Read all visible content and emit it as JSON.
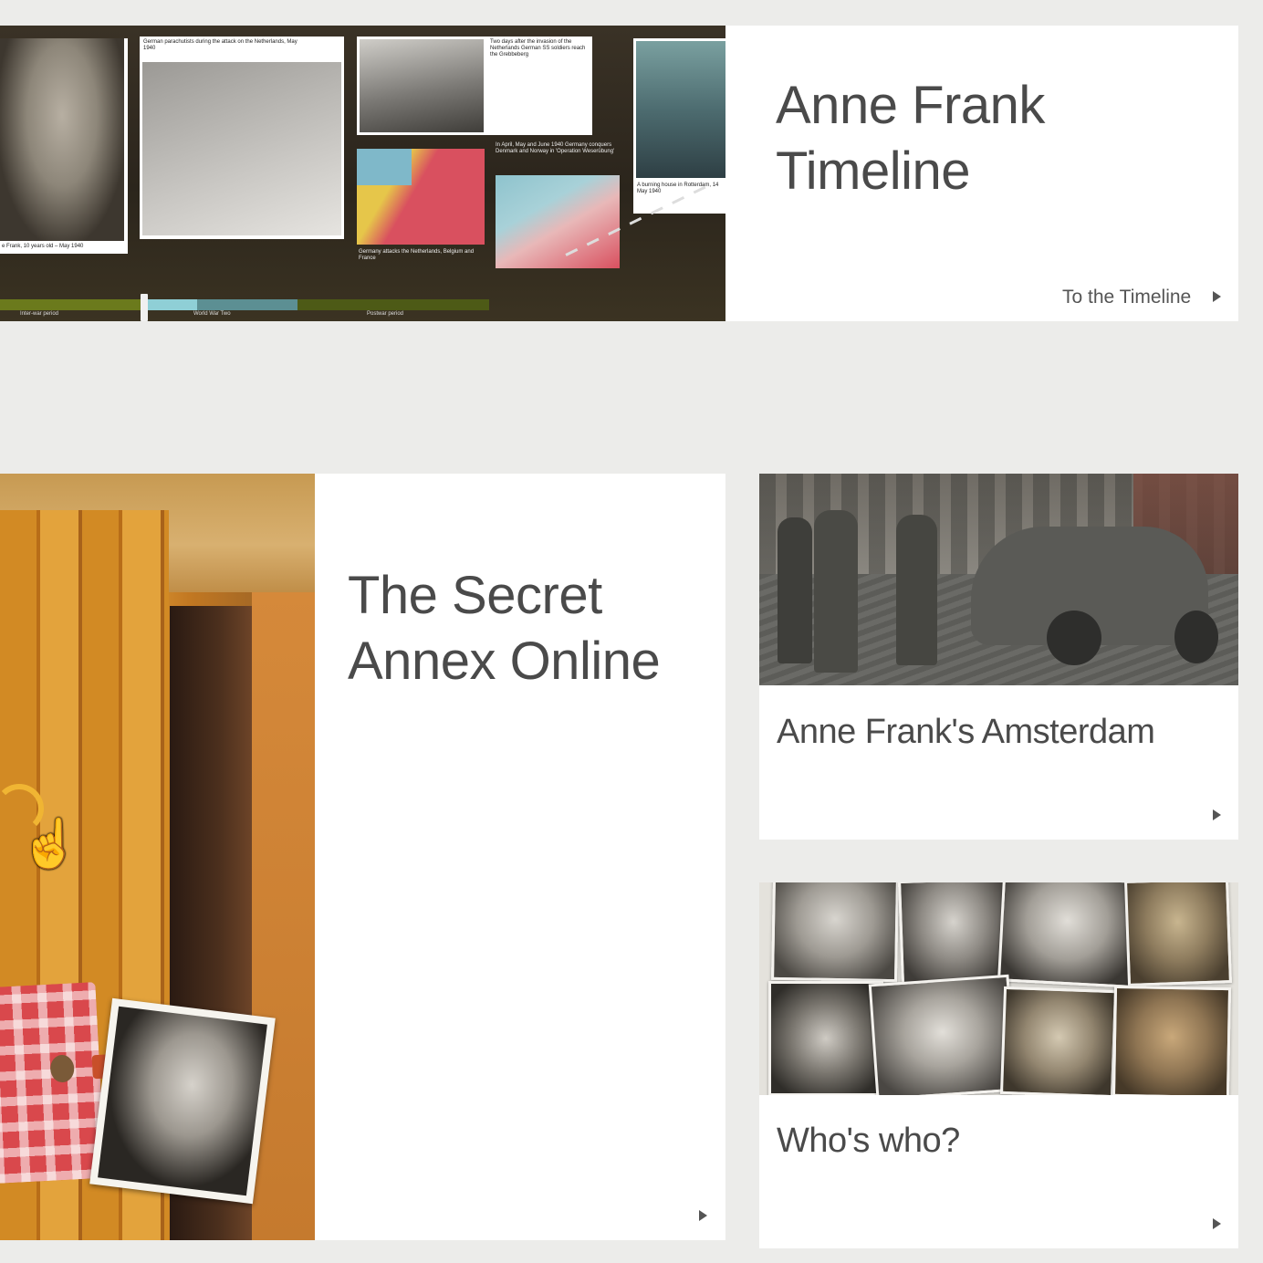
{
  "timeline": {
    "title_line1": "Anne Frank",
    "title_line2": "Timeline",
    "link_label": "To the Timeline",
    "image_captions": {
      "photo1": "e Frank, 10 years old – May 1940",
      "photo2": "German parachutists during the attack on the Netherlands, May 1940",
      "photo3": "Two days after the invasion of the Netherlands German SS soldiers reach the Grebbeberg",
      "photo4": "Germany attacks the Netherlands, Belgium and France",
      "photo5": "In April, May and June 1940 Germany conquers Denmark and Norway in 'Operation Weserübung'",
      "photo6": "A burning house in Rotterdam, 14 May 1940"
    },
    "periods": [
      "Inter-war period",
      "World War Two",
      "Postwar period"
    ]
  },
  "annex": {
    "title_line1": "The Secret",
    "title_line2": "Annex Online"
  },
  "amsterdam": {
    "title": "Anne Frank's Amsterdam"
  },
  "whoswho": {
    "title": "Who's who?"
  },
  "colors": {
    "page_background": "#ececea",
    "card_background": "#ffffff",
    "title_text": "#4a4a4a",
    "arrow": "#555555"
  }
}
